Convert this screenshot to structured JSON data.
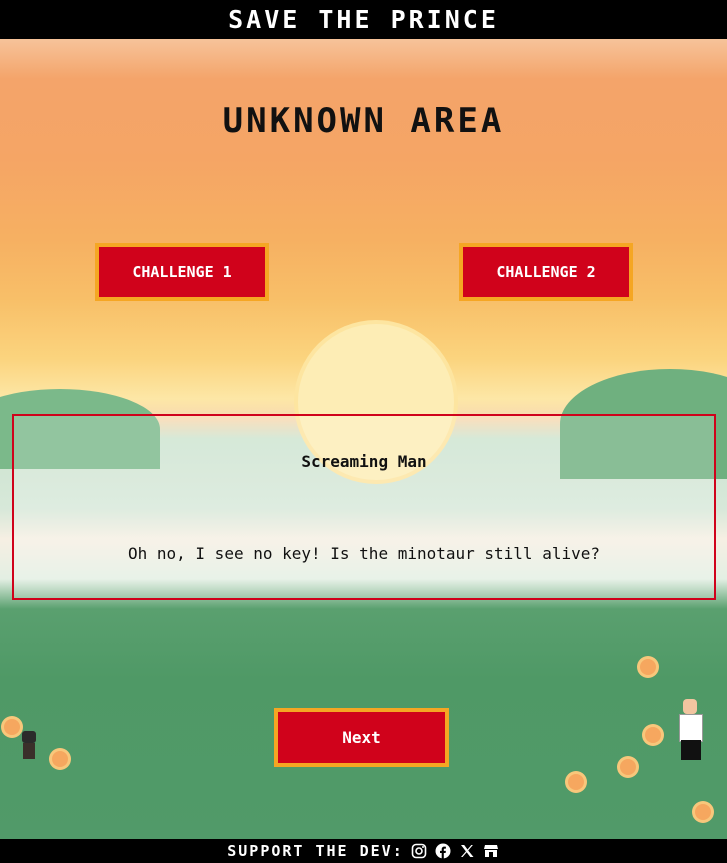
{
  "header": {
    "title": "SAVE THE PRINCE"
  },
  "area": {
    "title": "UNKNOWN AREA"
  },
  "challenges": [
    {
      "label": "CHALLENGE 1"
    },
    {
      "label": "CHALLENGE 2"
    }
  ],
  "dialog": {
    "speaker": "Screaming Man",
    "text": "Oh no, I see no key! Is the minotaur still alive?"
  },
  "next_button": {
    "label": "Next"
  },
  "footer": {
    "label": "SUPPORT THE DEV:",
    "icons": [
      "instagram-icon",
      "facebook-icon",
      "x-icon",
      "store-icon"
    ]
  },
  "colors": {
    "button_fill": "#d0021b",
    "button_border": "#f5a623",
    "dialog_border": "#d0021b",
    "bar_background": "#000000"
  }
}
